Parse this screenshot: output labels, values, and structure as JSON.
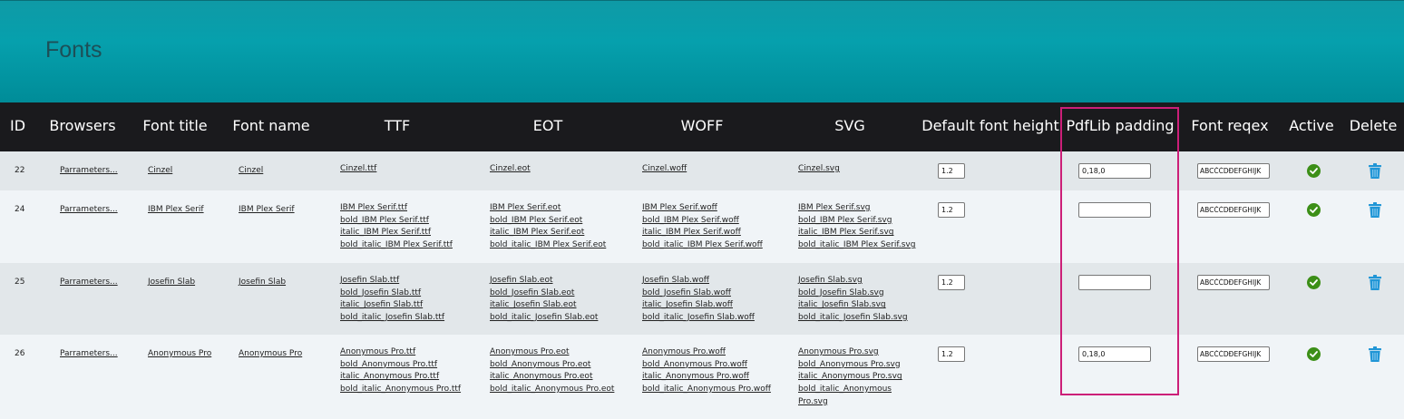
{
  "page": {
    "title": "Fonts"
  },
  "colors": {
    "header": "#0a9aa6",
    "table_head": "#1a1a1d",
    "active_check": "#3c8f17",
    "delete_icon": "#2196d6",
    "highlight": "#cc1f78"
  },
  "table": {
    "headers": [
      "ID",
      "Browsers",
      "Font title",
      "Font name",
      "TTF",
      "EOT",
      "WOFF",
      "SVG",
      "Default font height",
      "PdfLib padding",
      "Font reqex",
      "Active",
      "Delete"
    ],
    "rows": [
      {
        "id": "22",
        "browsers": "Parrameters...",
        "title": "Cinzel",
        "name": "Cinzel",
        "ttf": [
          "Cinzel.ttf"
        ],
        "eot": [
          "Cinzel.eot"
        ],
        "woff": [
          "Cinzel.woff"
        ],
        "svg": [
          "Cinzel.svg"
        ],
        "height": "1.2",
        "padding": "0,18,0",
        "regex": "ABCČĆDĐEFGHIJK",
        "active_icon": "check-circle-icon",
        "delete_icon": "trash-icon"
      },
      {
        "id": "24",
        "browsers": "Parrameters...",
        "title": "IBM Plex Serif",
        "name": "IBM Plex Serif",
        "ttf": [
          "IBM Plex Serif.ttf",
          "bold_IBM Plex Serif.ttf",
          "italic_IBM Plex Serif.ttf",
          "bold_italic_IBM Plex Serif.ttf"
        ],
        "eot": [
          "IBM Plex Serif.eot",
          "bold_IBM Plex Serif.eot",
          "italic_IBM Plex Serif.eot",
          "bold_italic_IBM Plex Serif.eot"
        ],
        "woff": [
          "IBM Plex Serif.woff",
          "bold_IBM Plex Serif.woff",
          "italic_IBM Plex Serif.woff",
          "bold_italic_IBM Plex Serif.woff"
        ],
        "svg": [
          "IBM Plex Serif.svg",
          "bold_IBM Plex Serif.svg",
          "italic_IBM Plex Serif.svg",
          "bold_italic_IBM Plex Serif.svg"
        ],
        "height": "1.2",
        "padding": "",
        "regex": "ABCČĆDĐEFGHIJK",
        "active_icon": "check-circle-icon",
        "delete_icon": "trash-icon"
      },
      {
        "id": "25",
        "browsers": "Parrameters...",
        "title": "Josefin Slab",
        "name": "Josefin Slab",
        "ttf": [
          "Josefin Slab.ttf",
          "bold_Josefin Slab.ttf",
          "italic_Josefin Slab.ttf",
          "bold_italic_Josefin Slab.ttf"
        ],
        "eot": [
          "Josefin Slab.eot",
          "bold_Josefin Slab.eot",
          "italic_Josefin Slab.eot",
          "bold_italic_Josefin Slab.eot"
        ],
        "woff": [
          "Josefin Slab.woff",
          "bold_Josefin Slab.woff",
          "italic_Josefin Slab.woff",
          "bold_italic_Josefin Slab.woff"
        ],
        "svg": [
          "Josefin Slab.svg",
          "bold_Josefin Slab.svg",
          "italic_Josefin Slab.svg",
          "bold_italic_Josefin Slab.svg"
        ],
        "height": "1.2",
        "padding": "",
        "regex": "ABCČĆDĐEFGHIJK",
        "active_icon": "check-circle-icon",
        "delete_icon": "trash-icon"
      },
      {
        "id": "26",
        "browsers": "Parrameters...",
        "title": "Anonymous Pro",
        "name": "Anonymous Pro",
        "ttf": [
          "Anonymous Pro.ttf",
          "bold_Anonymous Pro.ttf",
          "italic_Anonymous Pro.ttf",
          "bold_italic_Anonymous Pro.ttf"
        ],
        "eot": [
          "Anonymous Pro.eot",
          "bold_Anonymous Pro.eot",
          "italic_Anonymous Pro.eot",
          "bold_italic_Anonymous Pro.eot"
        ],
        "woff": [
          "Anonymous Pro.woff",
          "bold_Anonymous Pro.woff",
          "italic_Anonymous Pro.woff",
          "bold_italic_Anonymous Pro.woff"
        ],
        "svg": [
          "Anonymous Pro.svg",
          "bold_Anonymous Pro.svg",
          "italic_Anonymous Pro.svg",
          "bold_italic_Anonymous",
          "Pro.svg"
        ],
        "height": "1.2",
        "padding": "0,18,0",
        "regex": "ABCČĆDĐEFGHIJK",
        "active_icon": "check-circle-icon",
        "delete_icon": "trash-icon"
      }
    ]
  }
}
